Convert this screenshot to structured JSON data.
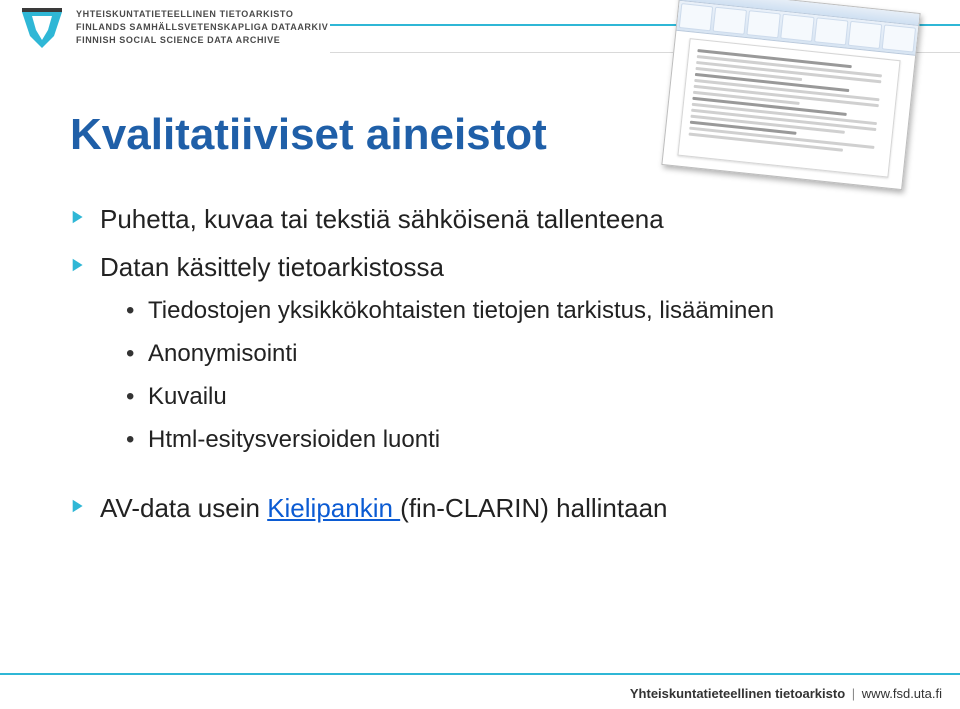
{
  "header": {
    "org_line1": "YHTEISKUNTATIETEELLINEN TIETOARKISTO",
    "org_line2": "FINLANDS SAMHÄLLSVETENSKAPLIGA DATAARKIV",
    "org_line3": "FINNISH SOCIAL SCIENCE DATA ARCHIVE"
  },
  "title": "Kvalitatiiviset aineistot",
  "bullets": {
    "b1": "Puhetta, kuvaa tai tekstiä sähköisenä tallenteena",
    "b2": "Datan käsittely tietoarkistossa",
    "b2_sub": {
      "s1": "Tiedostojen yksikkökohtaisten tietojen tarkistus, lisääminen",
      "s2": "Anonymisointi",
      "s3": "Kuvailu",
      "s4": "Html-esitysversioiden luonti"
    },
    "b3_pre": "AV-data usein ",
    "b3_link": "Kielipankin ",
    "b3_post": "(fin-CLARIN) hallintaan"
  },
  "footer": {
    "org": "Yhteiskuntatieteellinen tietoarkisto",
    "url": "www.fsd.uta.fi"
  }
}
